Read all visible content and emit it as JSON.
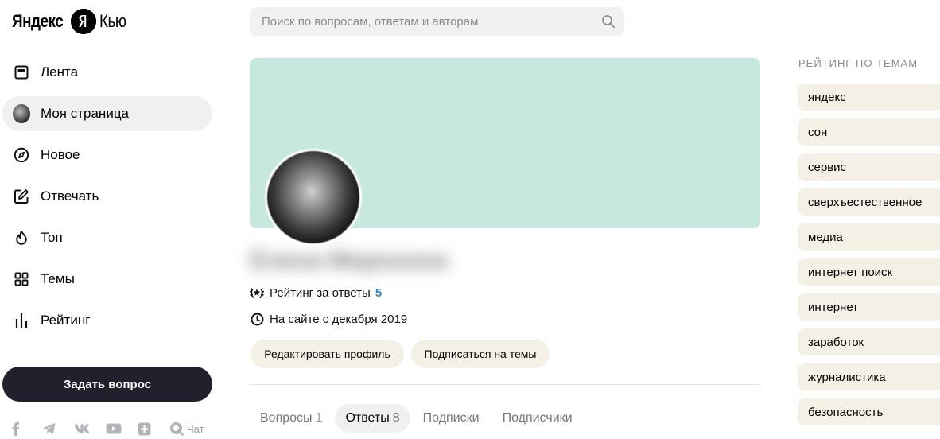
{
  "logo": {
    "part1": "Яндекс",
    "part2": "Кью",
    "mark": "Я"
  },
  "search": {
    "placeholder": "Поиск по вопросам, ответам и авторам",
    "value": "",
    "icon": "search-icon"
  },
  "nav": {
    "items": [
      {
        "label": "Лента",
        "icon": "feed-icon"
      },
      {
        "label": "Моя страница",
        "icon": "avatar"
      },
      {
        "label": "Новое",
        "icon": "compass-icon"
      },
      {
        "label": "Отвечать",
        "icon": "edit-icon"
      },
      {
        "label": "Топ",
        "icon": "fire-icon"
      },
      {
        "label": "Темы",
        "icon": "grid-icon"
      },
      {
        "label": "Рейтинг",
        "icon": "rating-bars-icon"
      }
    ],
    "active_index": 1,
    "ask_button": "Задать вопрос",
    "social": [
      "facebook-icon",
      "telegram-icon",
      "vk-icon",
      "youtube-icon",
      "plus-icon",
      "chat-icon"
    ],
    "chat_label": "Чат"
  },
  "profile": {
    "cover_color": "#c6e8de",
    "name_placeholder": "Елена Мирохина",
    "rating_label": "Рейтинг за ответы",
    "rating_value": "5",
    "since_label": "На сайте с декабря 2019",
    "edit_button": "Редактировать профиль",
    "subscribe_button": "Подписаться на темы"
  },
  "tabs": [
    {
      "label": "Вопросы",
      "count": "1"
    },
    {
      "label": "Ответы",
      "count": "8"
    },
    {
      "label": "Подписки",
      "count": ""
    },
    {
      "label": "Подписчики",
      "count": ""
    }
  ],
  "tabs_active_index": 1,
  "topics": {
    "title": "РЕЙТИНГ ПО ТЕМАМ",
    "items": [
      "яндекс",
      "сон",
      "сервис",
      "сверхъестественное",
      "медиа",
      "интернет поиск",
      "интернет",
      "заработок",
      "журналистика",
      "безопасность"
    ]
  },
  "colors": {
    "accent_dark": "#21212e",
    "pill_bg": "#f4f0e6",
    "active_bg": "#eff0f2",
    "rating_blue": "#2d87c8"
  }
}
